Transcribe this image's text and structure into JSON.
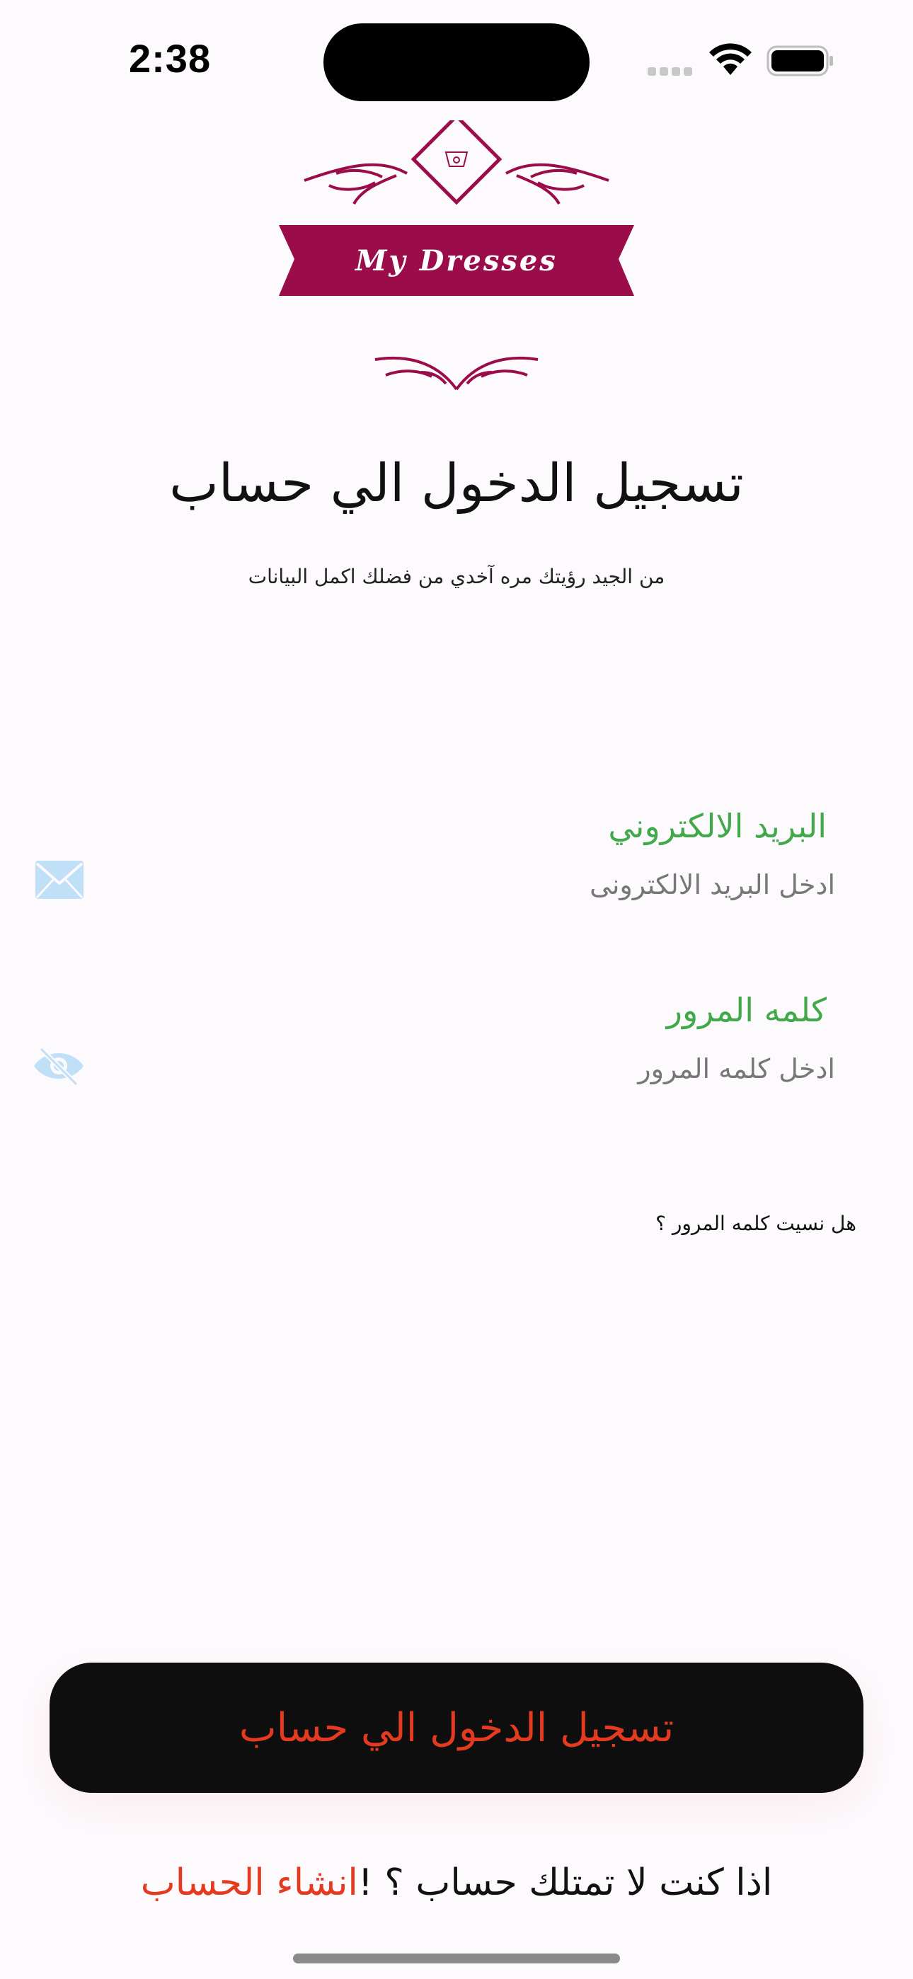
{
  "status_bar": {
    "time": "2:38"
  },
  "logo": {
    "text": "My Dresses",
    "brand_color": "#9a0d4a"
  },
  "header": {
    "title": "تسجيل الدخول الي حساب",
    "subtitle": "من الجيد رؤيتك مره آخدي من فضلك اكمل البيانات"
  },
  "email": {
    "label": "البريد الالكتروني",
    "placeholder": "ادخل البريد الالكترونى",
    "icon": "envelope-icon"
  },
  "password": {
    "label": "كلمه المرور",
    "placeholder": "ادخل كلمه المرور",
    "icon": "eye-slash-icon"
  },
  "forgot_password": "هل نسيت كلمه المرور ؟",
  "login_button": "تسجيل الدخول الي حساب",
  "signup": {
    "prompt": "اذا كنت لا تمتلك حساب ؟ !",
    "link": "انشاء الحساب"
  },
  "colors": {
    "accent_green": "#41a94a",
    "accent_red": "#e43a1f",
    "icon_blue": "#bfe0f7"
  }
}
